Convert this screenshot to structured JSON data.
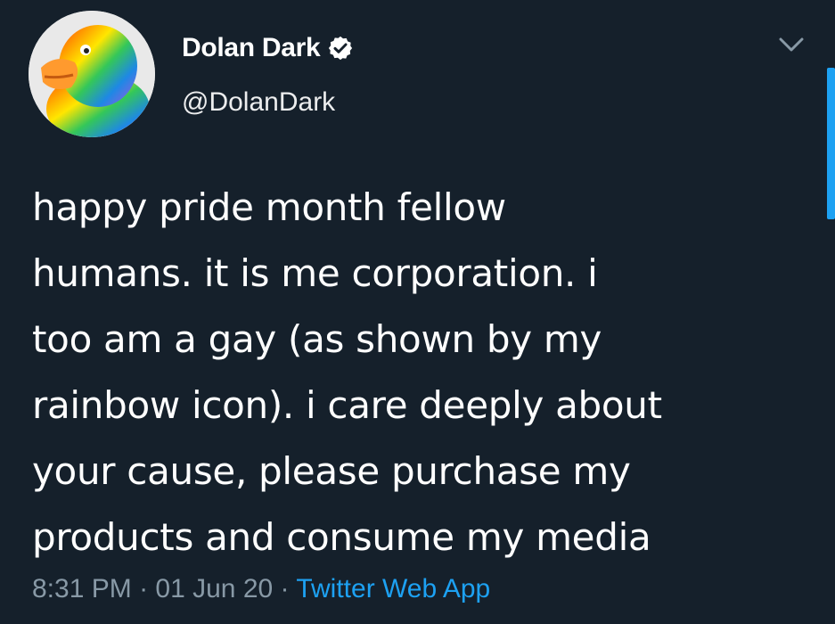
{
  "author": {
    "display_name": "Dolan Dark",
    "handle": "@DolanDark",
    "verified": true,
    "avatar_icon": "rainbow-dolan-avatar"
  },
  "tweet": {
    "text": "happy pride month fellow\nhumans. it is me corporation. i\ntoo am a gay (as shown by my\nrainbow icon). i care deeply about\nyour cause, please purchase my\nproducts and consume my media",
    "time": "8:31 PM",
    "separator": "·",
    "date": "01 Jun 20",
    "source": "Twitter Web App"
  },
  "icons": {
    "verified": "verified-badge-icon",
    "menu": "chevron-down-icon"
  },
  "colors": {
    "background": "#15202b",
    "text": "#ffffff",
    "muted": "#8899a6",
    "accent": "#1da1f2"
  }
}
